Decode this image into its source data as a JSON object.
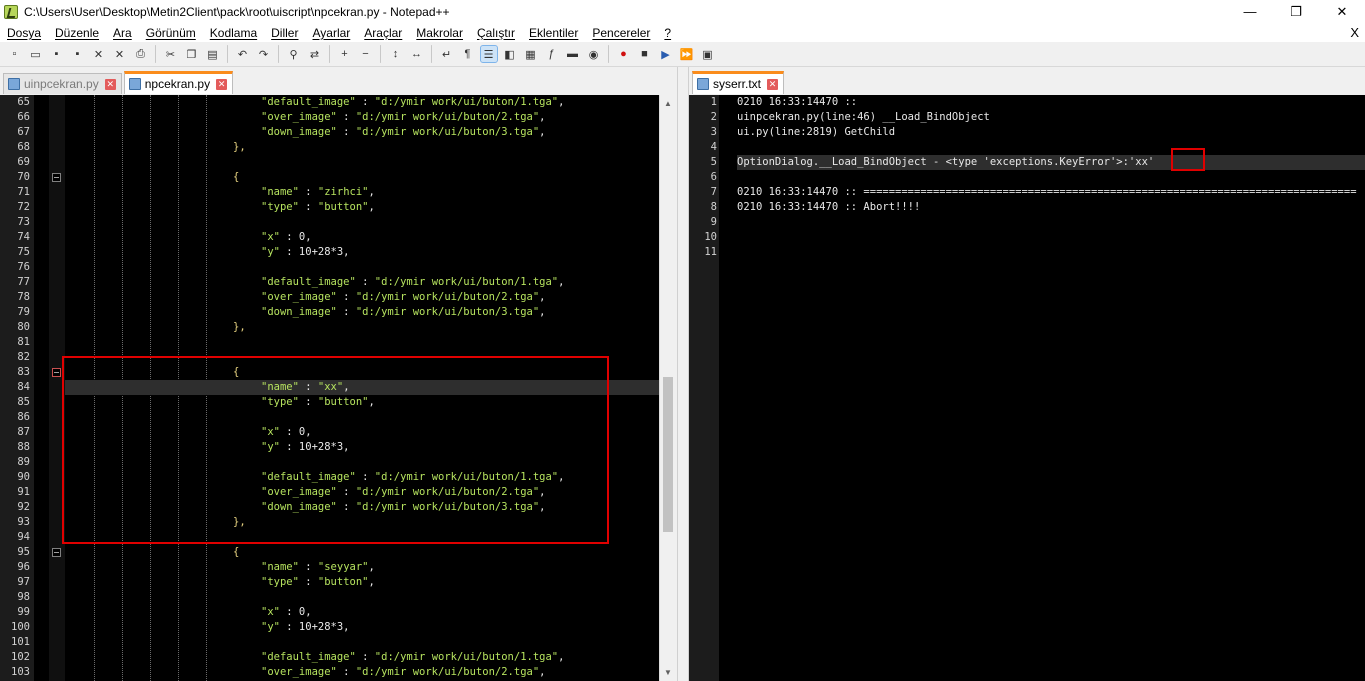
{
  "window": {
    "title": "C:\\Users\\User\\Desktop\\Metin2Client\\pack\\root\\uiscript\\npcekran.py - Notepad++",
    "minimize": "—",
    "restore": "❐",
    "close": "✕"
  },
  "menu": {
    "items": [
      "Dosya",
      "Düzenle",
      "Ara",
      "Görünüm",
      "Kodlama",
      "Diller",
      "Ayarlar",
      "Araçlar",
      "Makrolar",
      "Çalıştır",
      "Eklentiler",
      "Pencereler",
      "?"
    ],
    "close_doc": "X"
  },
  "toolbar": {
    "icons": [
      "new-file-icon",
      "open-file-icon",
      "save-icon",
      "save-all-icon",
      "close-icon",
      "close-all-icon",
      "print-icon",
      "cut-icon",
      "copy-icon",
      "paste-icon",
      "undo-icon",
      "redo-icon",
      "find-icon",
      "replace-icon",
      "zoom-in-icon",
      "zoom-out-icon",
      "sync-v-icon",
      "sync-h-icon",
      "word-wrap-icon",
      "show-all-chars-icon",
      "indent-guide-icon",
      "user-lang-icon",
      "doc-map-icon",
      "function-list-icon",
      "folder-workspace-icon",
      "monitor-icon",
      "record-macro-icon",
      "stop-macro-icon",
      "play-macro-icon",
      "run-macro-multiple-icon",
      "save-macro-icon"
    ]
  },
  "left_tabs": [
    {
      "label": "uinpcekran.py",
      "active": false
    },
    {
      "label": "npcekran.py",
      "active": true
    }
  ],
  "right_tabs": [
    {
      "label": "syserr.txt",
      "active": true
    }
  ],
  "left_editor": {
    "line_numbers": [
      "65",
      "66",
      "67",
      "68",
      "69",
      "70",
      "71",
      "72",
      "73",
      "74",
      "75",
      "76",
      "77",
      "78",
      "79",
      "80",
      "81",
      "82",
      "83",
      "84",
      "85",
      "86",
      "87",
      "88",
      "89",
      "90",
      "91",
      "92",
      "93",
      "94",
      "95",
      "96",
      "97",
      "98",
      "99",
      "100",
      "101",
      "102",
      "103"
    ],
    "current_line_index": 19,
    "lines": [
      [
        {
          "t": "s",
          "v": "\"default_image\""
        },
        {
          "t": "p",
          "v": " : "
        },
        {
          "t": "s",
          "v": "\"d:/ymir work/ui/buton/1.tga\""
        },
        {
          "t": "p",
          "v": ","
        }
      ],
      [
        {
          "t": "s",
          "v": "\"over_image\""
        },
        {
          "t": "p",
          "v": " : "
        },
        {
          "t": "s",
          "v": "\"d:/ymir work/ui/buton/2.tga\""
        },
        {
          "t": "p",
          "v": ","
        }
      ],
      [
        {
          "t": "s",
          "v": "\"down_image\""
        },
        {
          "t": "p",
          "v": " : "
        },
        {
          "t": "s",
          "v": "\"d:/ymir work/ui/buton/3.tga\""
        },
        {
          "t": "p",
          "v": ","
        }
      ],
      [
        {
          "t": "b",
          "v": "},"
        }
      ],
      [],
      [
        {
          "t": "b",
          "v": "{"
        }
      ],
      [
        {
          "t": "s",
          "v": "\"name\""
        },
        {
          "t": "p",
          "v": " : "
        },
        {
          "t": "s",
          "v": "\"zirhci\""
        },
        {
          "t": "p",
          "v": ","
        }
      ],
      [
        {
          "t": "s",
          "v": "\"type\""
        },
        {
          "t": "p",
          "v": " : "
        },
        {
          "t": "s",
          "v": "\"button\""
        },
        {
          "t": "p",
          "v": ","
        }
      ],
      [],
      [
        {
          "t": "s",
          "v": "\"x\""
        },
        {
          "t": "p",
          "v": " : 0,"
        }
      ],
      [
        {
          "t": "s",
          "v": "\"y\""
        },
        {
          "t": "p",
          "v": " : 10+28*3,"
        }
      ],
      [],
      [
        {
          "t": "s",
          "v": "\"default_image\""
        },
        {
          "t": "p",
          "v": " : "
        },
        {
          "t": "s",
          "v": "\"d:/ymir work/ui/buton/1.tga\""
        },
        {
          "t": "p",
          "v": ","
        }
      ],
      [
        {
          "t": "s",
          "v": "\"over_image\""
        },
        {
          "t": "p",
          "v": " : "
        },
        {
          "t": "s",
          "v": "\"d:/ymir work/ui/buton/2.tga\""
        },
        {
          "t": "p",
          "v": ","
        }
      ],
      [
        {
          "t": "s",
          "v": "\"down_image\""
        },
        {
          "t": "p",
          "v": " : "
        },
        {
          "t": "s",
          "v": "\"d:/ymir work/ui/buton/3.tga\""
        },
        {
          "t": "p",
          "v": ","
        }
      ],
      [
        {
          "t": "b",
          "v": "},"
        }
      ],
      [],
      [],
      [
        {
          "t": "b",
          "v": "{"
        }
      ],
      [
        {
          "t": "s",
          "v": "\"name\""
        },
        {
          "t": "p",
          "v": " : "
        },
        {
          "t": "s",
          "v": "\"xx\""
        },
        {
          "t": "p",
          "v": ","
        }
      ],
      [
        {
          "t": "s",
          "v": "\"type\""
        },
        {
          "t": "p",
          "v": " : "
        },
        {
          "t": "s",
          "v": "\"button\""
        },
        {
          "t": "p",
          "v": ","
        }
      ],
      [],
      [
        {
          "t": "s",
          "v": "\"x\""
        },
        {
          "t": "p",
          "v": " : 0,"
        }
      ],
      [
        {
          "t": "s",
          "v": "\"y\""
        },
        {
          "t": "p",
          "v": " : 10+28*3,"
        }
      ],
      [],
      [
        {
          "t": "s",
          "v": "\"default_image\""
        },
        {
          "t": "p",
          "v": " : "
        },
        {
          "t": "s",
          "v": "\"d:/ymir work/ui/buton/1.tga\""
        },
        {
          "t": "p",
          "v": ","
        }
      ],
      [
        {
          "t": "s",
          "v": "\"over_image\""
        },
        {
          "t": "p",
          "v": " : "
        },
        {
          "t": "s",
          "v": "\"d:/ymir work/ui/buton/2.tga\""
        },
        {
          "t": "p",
          "v": ","
        }
      ],
      [
        {
          "t": "s",
          "v": "\"down_image\""
        },
        {
          "t": "p",
          "v": " : "
        },
        {
          "t": "s",
          "v": "\"d:/ymir work/ui/buton/3.tga\""
        },
        {
          "t": "p",
          "v": ","
        }
      ],
      [
        {
          "t": "b",
          "v": "},"
        }
      ],
      [],
      [
        {
          "t": "b",
          "v": "{"
        }
      ],
      [
        {
          "t": "s",
          "v": "\"name\""
        },
        {
          "t": "p",
          "v": " : "
        },
        {
          "t": "s",
          "v": "\"seyyar\""
        },
        {
          "t": "p",
          "v": ","
        }
      ],
      [
        {
          "t": "s",
          "v": "\"type\""
        },
        {
          "t": "p",
          "v": " : "
        },
        {
          "t": "s",
          "v": "\"button\""
        },
        {
          "t": "p",
          "v": ","
        }
      ],
      [],
      [
        {
          "t": "s",
          "v": "\"x\""
        },
        {
          "t": "p",
          "v": " : 0,"
        }
      ],
      [
        {
          "t": "s",
          "v": "\"y\""
        },
        {
          "t": "p",
          "v": " : 10+28*3,"
        }
      ],
      [],
      [
        {
          "t": "s",
          "v": "\"default_image\""
        },
        {
          "t": "p",
          "v": " : "
        },
        {
          "t": "s",
          "v": "\"d:/ymir work/ui/buton/1.tga\""
        },
        {
          "t": "p",
          "v": ","
        }
      ],
      [
        {
          "t": "s",
          "v": "\"over_image\""
        },
        {
          "t": "p",
          "v": " : "
        },
        {
          "t": "s",
          "v": "\"d:/ymir work/ui/buton/2.tga\""
        },
        {
          "t": "p",
          "v": ","
        }
      ]
    ],
    "fold_markers": [
      5,
      18,
      30
    ]
  },
  "right_editor": {
    "line_numbers": [
      "1",
      "2",
      "3",
      "4",
      "5",
      "6",
      "7",
      "8",
      "9",
      "10",
      "11"
    ],
    "current_line_index": 4,
    "lines": [
      "0210 16:33:14470 ::",
      "uinpcekran.py(line:46) __Load_BindObject",
      "ui.py(line:2819) GetChild",
      "",
      "OptionDialog.__Load_BindObject - <type 'exceptions.KeyError'>:'xx'",
      "",
      "0210 16:33:14470 :: ==============================================================================",
      "0210 16:33:14470 :: Abort!!!!",
      "",
      "",
      ""
    ]
  },
  "colors": {
    "editor_bg": "#000000",
    "string": "#b6e35f",
    "brace": "#e6d280",
    "highlight_box": "#e00000",
    "active_tab_accent": "#fa8c1c"
  }
}
